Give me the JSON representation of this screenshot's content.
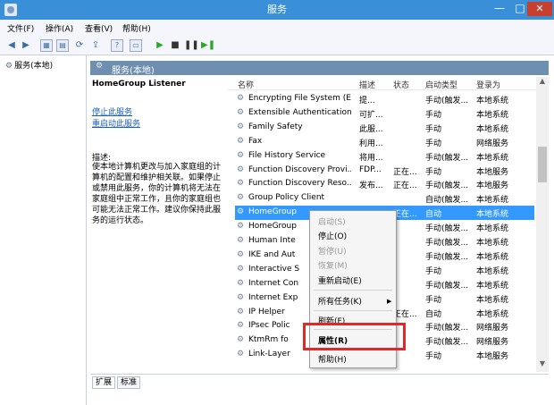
{
  "window": {
    "title": "服务",
    "min": "—",
    "max": "□",
    "close": "✕"
  },
  "menu": [
    "文件(F)",
    "操作(A)",
    "查看(V)",
    "帮助(H)"
  ],
  "toolbar_icons": [
    "back-arrow-icon",
    "forward-arrow-icon",
    "tree-view-icon",
    "list-view-icon",
    "refresh-icon",
    "export-icon",
    "help-icon",
    "console-icon",
    "start-icon",
    "stop-icon",
    "pause-icon",
    "restart-icon"
  ],
  "tree": {
    "root_label": "服务(本地)"
  },
  "panel": {
    "title": "服务(本地)"
  },
  "description": {
    "service_name": "HomeGroup Listener",
    "stop_link": "停止此服务",
    "restart_link": "重启动此服务",
    "label": "描述:",
    "text": "使本地计算机更改与加入家庭组的计\n算机的配置和维护相关联。如果停止\n或禁用此服务，你的计算机将无法在\n家庭组中正常工作，且你的家庭组也\n可能无法正常工作。建议你保持此服\n务的运行状态。"
  },
  "columns": [
    "名称",
    "描述",
    "状态",
    "启动类型",
    "登录为"
  ],
  "rows": [
    {
      "name": "Encrypting File System (E...",
      "desc": "提...",
      "status": "",
      "startup": "手动(触发...",
      "logon": "本地系统"
    },
    {
      "name": "Extensible Authentication...",
      "desc": "可扩...",
      "status": "",
      "startup": "手动",
      "logon": "本地系统"
    },
    {
      "name": "Family Safety",
      "desc": "此服...",
      "status": "",
      "startup": "手动",
      "logon": "本地系统"
    },
    {
      "name": "Fax",
      "desc": "利用...",
      "status": "",
      "startup": "手动",
      "logon": "网络服务"
    },
    {
      "name": "File History Service",
      "desc": "将用...",
      "status": "",
      "startup": "手动(触发...",
      "logon": "本地系统"
    },
    {
      "name": "Function Discovery Provi...",
      "desc": "FDP...",
      "status": "正在...",
      "startup": "手动",
      "logon": "本地服务"
    },
    {
      "name": "Function Discovery Reso...",
      "desc": "发布...",
      "status": "正在...",
      "startup": "手动(触发...",
      "logon": "本地服务"
    },
    {
      "name": "Group Policy Client",
      "desc": "",
      "status": "",
      "startup": "自动(触发...",
      "logon": "本地系统"
    },
    {
      "name": "HomeGroup",
      "desc": "",
      "status": "正在...",
      "startup": "自动",
      "logon": "本地系统",
      "selected": true
    },
    {
      "name": "HomeGroup",
      "desc": "",
      "status": "",
      "startup": "手动(触发...",
      "logon": "本地系统"
    },
    {
      "name": "Human Inte",
      "desc": "",
      "status": "",
      "startup": "手动(触发...",
      "logon": "本地系统"
    },
    {
      "name": "IKE and Aut",
      "desc": "",
      "status": "",
      "startup": "手动(触发...",
      "logon": "本地系统"
    },
    {
      "name": "Interactive S",
      "desc": "",
      "status": "",
      "startup": "手动",
      "logon": "本地系统"
    },
    {
      "name": "Internet Con",
      "desc": "",
      "status": "",
      "startup": "手动(触发...",
      "logon": "本地系统"
    },
    {
      "name": "Internet Exp",
      "desc": "",
      "status": "",
      "startup": "手动",
      "logon": "本地系统"
    },
    {
      "name": "IP Helper",
      "desc": "",
      "status": "正在...",
      "startup": "自动",
      "logon": "本地系统"
    },
    {
      "name": "IPsec Polic",
      "desc": "",
      "status": "",
      "startup": "手动(触发...",
      "logon": "网络服务"
    },
    {
      "name": "KtmRm fo",
      "desc": "",
      "status": "",
      "startup": "手动(触发...",
      "logon": "网络服务"
    },
    {
      "name": "Link-Layer",
      "desc": "",
      "status": "",
      "startup": "手动",
      "logon": "本地服务"
    }
  ],
  "context_menu": {
    "start": "启动(S)",
    "stop": "停止(O)",
    "pause": "暂停(U)",
    "resume": "恢复(M)",
    "restart": "重新启动(E)",
    "all_tasks": "所有任务(K)",
    "refresh": "刷新(F)",
    "properties": "属性(R)",
    "help": "帮助(H)"
  },
  "tabs": [
    "扩展",
    "标准"
  ],
  "colors": {
    "titlebar": "#3a8fd9",
    "selection": "#3399ff",
    "panel_header": "#6f8fb1",
    "highlight": "#e32626",
    "link": "#1d5fbf"
  }
}
